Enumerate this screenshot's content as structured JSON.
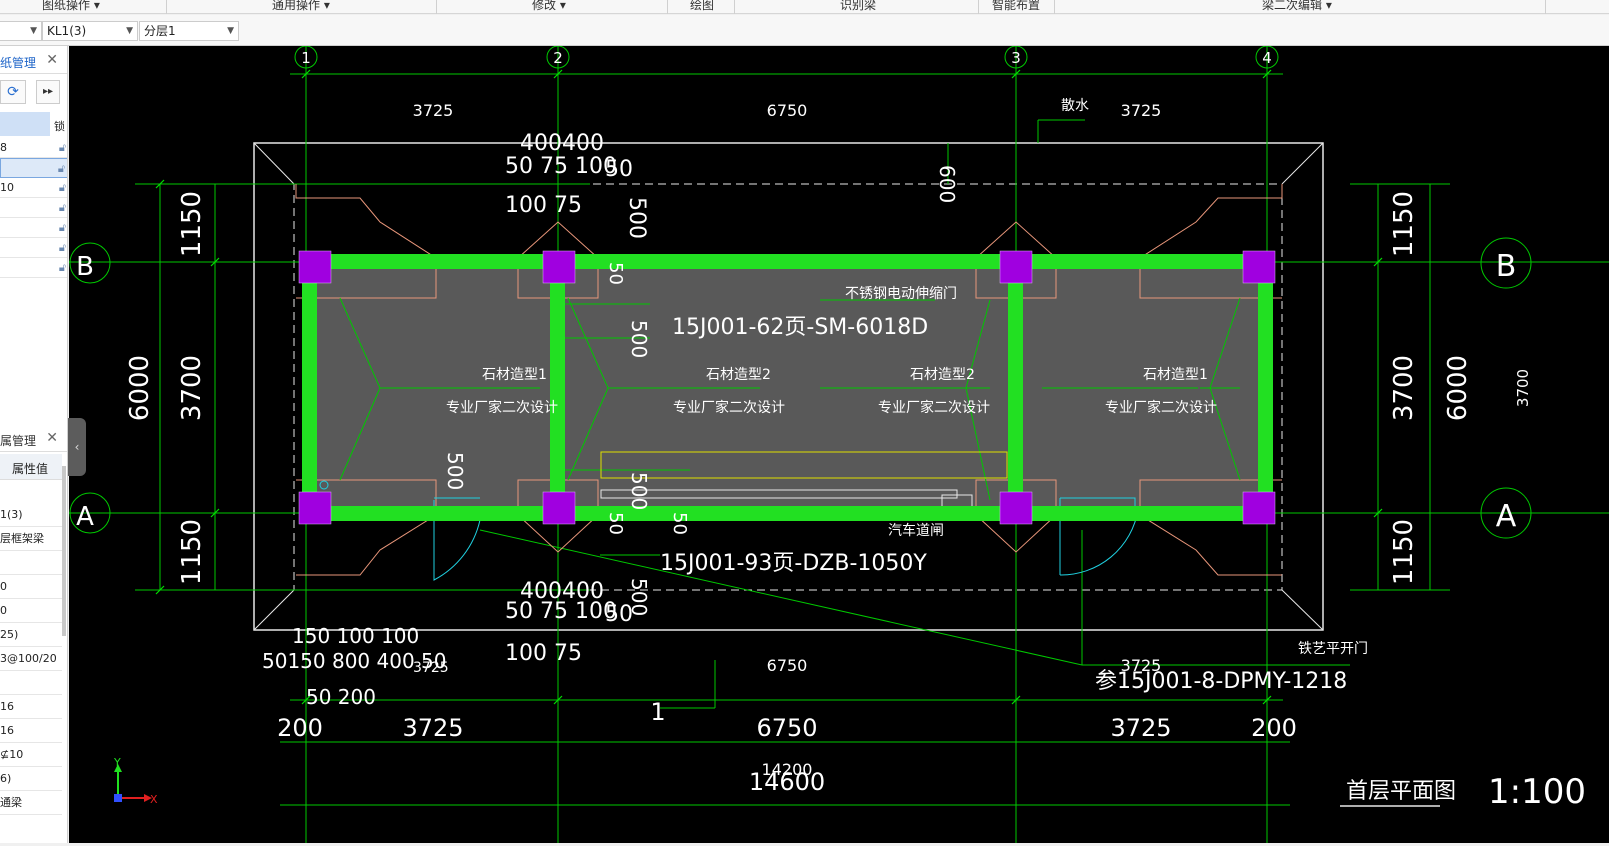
{
  "ribbon": {
    "groups": [
      "图纸操作",
      "通用操作",
      "修改",
      "绘图",
      "识别梁",
      "智能布置",
      "梁二次编辑"
    ]
  },
  "toolbar": {
    "element_select": "KL1(3)",
    "layer_select": "分层1"
  },
  "drawing_panel": {
    "title": "纸管理",
    "column_header": "锁",
    "rows": [
      "8",
      "",
      "10",
      "",
      "",
      "",
      ""
    ]
  },
  "property_panel": {
    "title": "属管理",
    "column_header": "属性值",
    "rows": [
      "1(3)",
      "层框架梁",
      "",
      "0",
      "0",
      "25)",
      "3@100/20",
      "",
      "16",
      "16",
      "⊈10",
      "6)",
      "通梁"
    ]
  },
  "cad": {
    "axes_top": [
      "1",
      "2",
      "3",
      "4"
    ],
    "axes_side": [
      "B",
      "A"
    ],
    "dims_top": [
      "3725",
      "6750",
      "3725"
    ],
    "dims_bottom": [
      "3725",
      "6750",
      "3725"
    ],
    "dims_bottom_big": [
      "200",
      "3725",
      "6750",
      "3725",
      "200"
    ],
    "overall_inner": "14200",
    "overall_outer": "14600",
    "dims_left": [
      "1150",
      "3700",
      "1150"
    ],
    "dims_left_total": "6000",
    "dims_right": [
      "1150",
      "3700",
      "1150"
    ],
    "dims_right_total": "6000",
    "dim_right_white": "3700",
    "slope_note": "散水",
    "dim_600": "600",
    "dim_500": "500",
    "dim_50": "50",
    "dim_400400": "400400",
    "dim_50_75_100": "50 75 100",
    "dim_100_75": "100 75",
    "dim_bottom_left_row1": "150 100 100",
    "dim_bottom_left_row2": "50150 800 400 50",
    "dim_bottom_left_row3": "50 200",
    "dim_3725_small": "3725",
    "door_top_name": "不锈钢电动伸缩门",
    "door_top_ref": "15J001-62页-SM-6018D",
    "stone_1": "石材造型1",
    "stone_2": "石材造型2",
    "vendor": "专业厂家二次设计",
    "gate_label": "汽车道闸",
    "gate_ref": "15J001-93页-DZB-1050Y",
    "door_right_name": "铁艺平开门",
    "door_right_ref": "参15J001-8-DPMY-1218",
    "index_number": "1",
    "title": "首层平面图",
    "scale": "1:100",
    "ucs_x": "X",
    "ucs_y": "Y",
    "colors": {
      "beam": "#22e022",
      "column": "#a000e0",
      "axis": "#00c800",
      "slab": "#555555",
      "outline": "#e8967a"
    }
  }
}
